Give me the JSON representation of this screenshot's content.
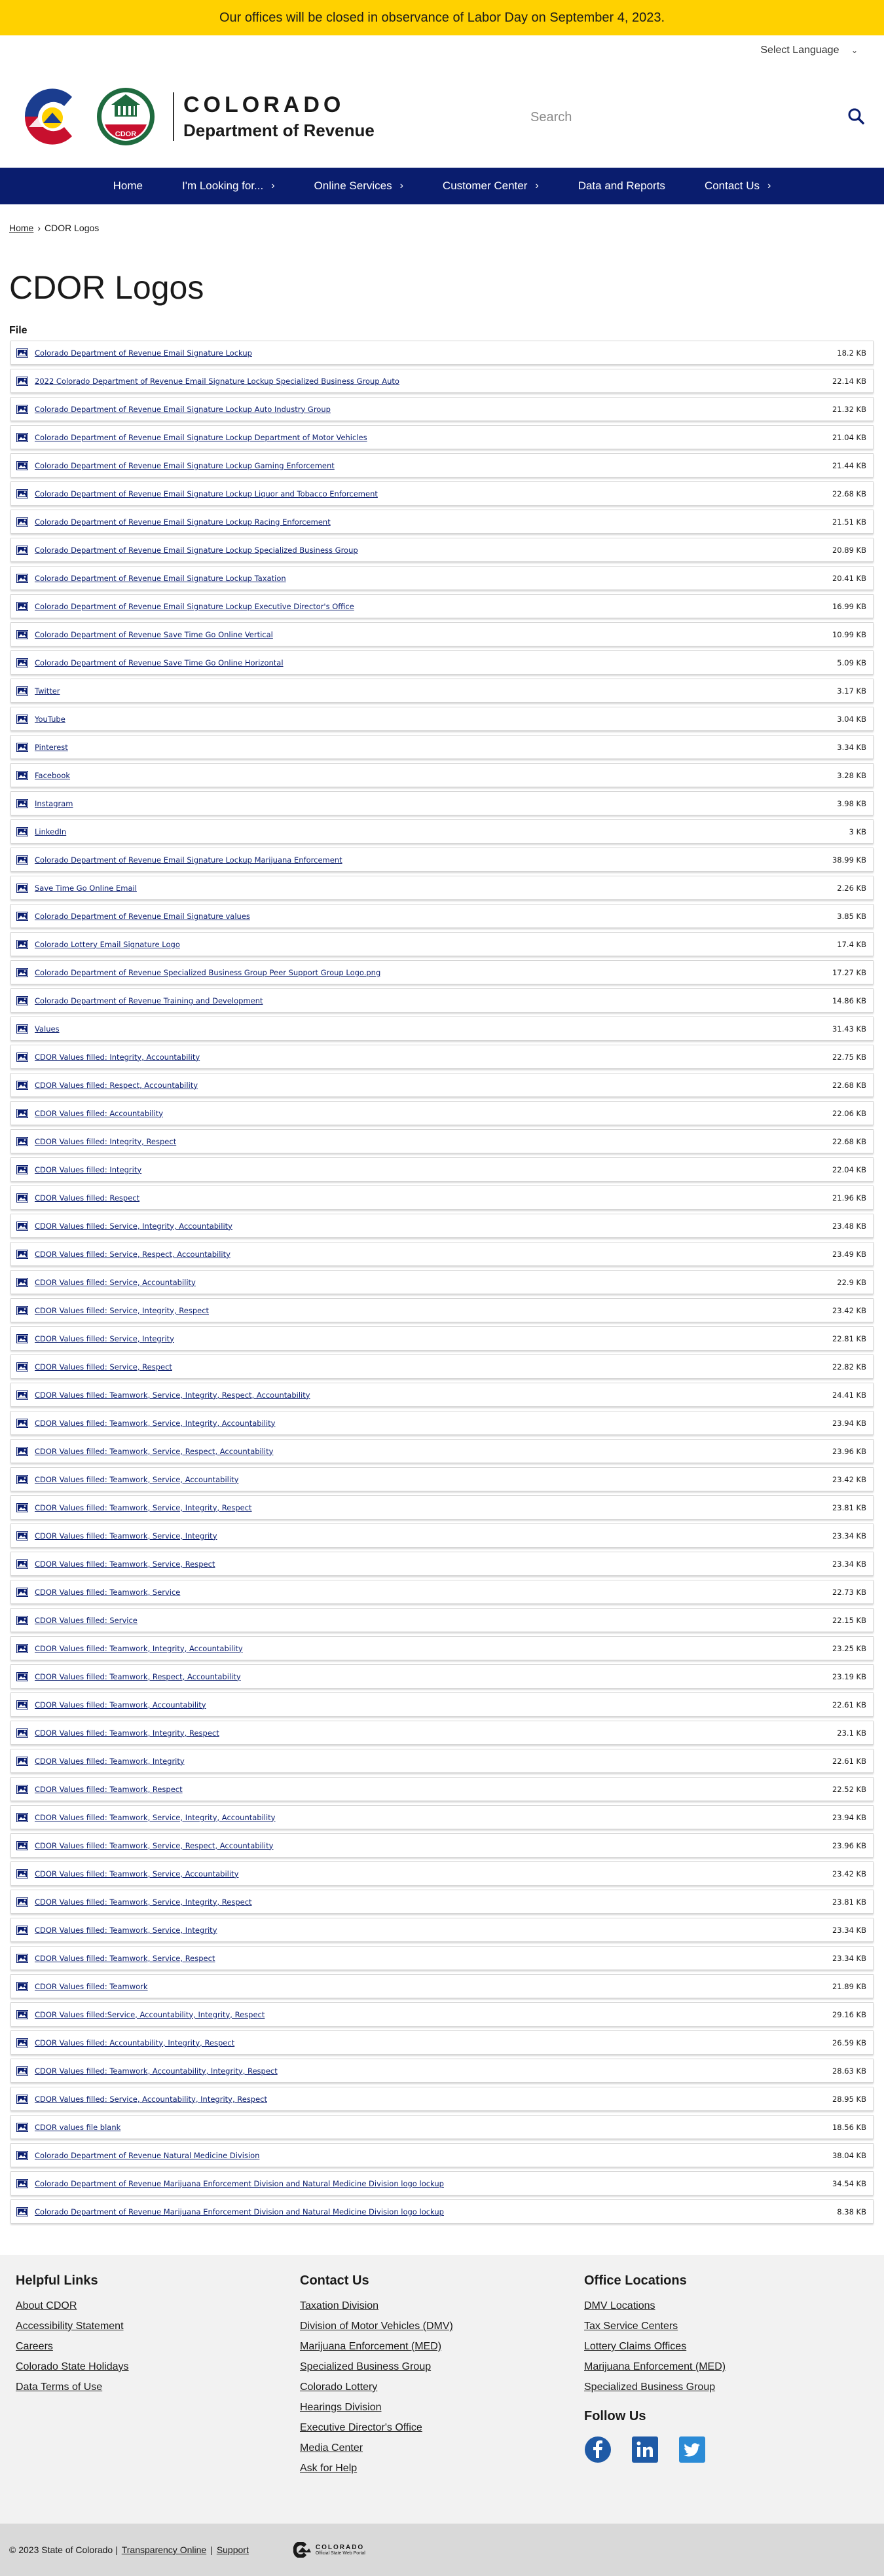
{
  "alert": {
    "text": "Our offices will be closed in observance of Labor Day on September 4, 2023."
  },
  "language": {
    "label": "Select Language"
  },
  "header": {
    "state_name": "COLORADO",
    "dept_name": "Department of Revenue",
    "cdor_badge": "CDOR",
    "search_placeholder": "Search"
  },
  "nav": {
    "items": [
      {
        "label": "Home"
      },
      {
        "label": "I'm Looking for..."
      },
      {
        "label": "Online Services"
      },
      {
        "label": "Customer Center"
      },
      {
        "label": "Data and Reports"
      },
      {
        "label": "Contact Us"
      }
    ]
  },
  "breadcrumb": {
    "home": "Home",
    "current": "CDOR Logos"
  },
  "page_title": "CDOR Logos",
  "file_label": "File",
  "files": [
    {
      "name": "Colorado Department of Revenue Email Signature Lockup",
      "size": "18.2 KB"
    },
    {
      "name": "2022 Colorado Department of Revenue Email Signature Lockup Specialized Business Group Auto",
      "size": "22.14 KB"
    },
    {
      "name": "Colorado Department of Revenue Email Signature Lockup Auto Industry Group",
      "size": "21.32 KB"
    },
    {
      "name": "Colorado Department of Revenue Email Signature Lockup Department of Motor Vehicles",
      "size": "21.04 KB"
    },
    {
      "name": "Colorado Department of Revenue Email Signature Lockup Gaming Enforcement",
      "size": "21.44 KB"
    },
    {
      "name": "Colorado Department of Revenue Email Signature Lockup Liquor and Tobacco Enforcement",
      "size": "22.68 KB"
    },
    {
      "name": "Colorado Department of Revenue Email Signature Lockup Racing Enforcement",
      "size": "21.51 KB"
    },
    {
      "name": "Colorado Department of Revenue Email Signature Lockup Specialized Business Group",
      "size": "20.89 KB"
    },
    {
      "name": "Colorado Department of Revenue Email Signature Lockup Taxation",
      "size": "20.41 KB"
    },
    {
      "name": "Colorado Department of Revenue Email Signature Lockup Executive Director's Office",
      "size": "16.99 KB"
    },
    {
      "name": "Colorado Department of Revenue Save Time Go Online Vertical",
      "size": "10.99 KB"
    },
    {
      "name": "Colorado Department of Revenue Save Time Go Online Horizontal",
      "size": "5.09 KB"
    },
    {
      "name": "Twitter",
      "size": "3.17 KB"
    },
    {
      "name": "YouTube",
      "size": "3.04 KB"
    },
    {
      "name": "Pinterest",
      "size": "3.34 KB"
    },
    {
      "name": "Facebook",
      "size": "3.28 KB"
    },
    {
      "name": "Instagram",
      "size": "3.98 KB"
    },
    {
      "name": "LinkedIn",
      "size": "3 KB"
    },
    {
      "name": "Colorado Department of Revenue Email Signature Lockup Marijuana Enforcement",
      "size": "38.99 KB"
    },
    {
      "name": "Save Time Go Online Email",
      "size": "2.26 KB"
    },
    {
      "name": "Colorado Department of Revenue Email Signature values",
      "size": "3.85 KB"
    },
    {
      "name": "Colorado Lottery Email Signature Logo",
      "size": "17.4 KB"
    },
    {
      "name": "Colorado Department of Revenue Specialized Business Group Peer Support Group Logo.png",
      "size": "17.27 KB"
    },
    {
      "name": "Colorado Department of Revenue Training and Development",
      "size": "14.86 KB"
    },
    {
      "name": "Values",
      "size": "31.43 KB"
    },
    {
      "name": "CDOR Values filled: Integrity, Accountability",
      "size": "22.75 KB"
    },
    {
      "name": "CDOR Values filled: Respect, Accountability",
      "size": "22.68 KB"
    },
    {
      "name": "CDOR Values filled: Accountability",
      "size": "22.06 KB"
    },
    {
      "name": "CDOR Values filled: Integrity, Respect",
      "size": "22.68 KB"
    },
    {
      "name": "CDOR Values filled: Integrity",
      "size": "22.04 KB"
    },
    {
      "name": "CDOR Values filled: Respect",
      "size": "21.96 KB"
    },
    {
      "name": "CDOR Values filled: Service, Integrity, Accountability",
      "size": "23.48 KB"
    },
    {
      "name": "CDOR Values filled: Service, Respect, Accountability",
      "size": "23.49 KB"
    },
    {
      "name": "CDOR Values filled: Service, Accountability",
      "size": "22.9 KB"
    },
    {
      "name": "CDOR Values filled: Service, Integrity, Respect",
      "size": "23.42 KB"
    },
    {
      "name": "CDOR Values filled: Service, Integrity",
      "size": "22.81 KB"
    },
    {
      "name": "CDOR Values filled: Service, Respect",
      "size": "22.82 KB"
    },
    {
      "name": "CDOR Values filled: Teamwork, Service, Integrity, Respect, Accountability",
      "size": "24.41 KB"
    },
    {
      "name": "CDOR Values filled: Teamwork, Service, Integrity, Accountability",
      "size": "23.94 KB"
    },
    {
      "name": "CDOR Values filled: Teamwork, Service, Respect, Accountability",
      "size": "23.96 KB"
    },
    {
      "name": "CDOR Values filled: Teamwork, Service, Accountability",
      "size": "23.42 KB"
    },
    {
      "name": "CDOR Values filled: Teamwork, Service, Integrity, Respect",
      "size": "23.81 KB"
    },
    {
      "name": "CDOR Values filled: Teamwork, Service, Integrity",
      "size": "23.34 KB"
    },
    {
      "name": "CDOR Values filled: Teamwork, Service, Respect",
      "size": "23.34 KB"
    },
    {
      "name": "CDOR Values filled: Teamwork, Service",
      "size": "22.73 KB"
    },
    {
      "name": "CDOR Values filled: Service",
      "size": "22.15 KB"
    },
    {
      "name": "CDOR Values filled: Teamwork, Integrity, Accountability",
      "size": "23.25 KB"
    },
    {
      "name": "CDOR Values filled: Teamwork, Respect, Accountability",
      "size": "23.19 KB"
    },
    {
      "name": "CDOR Values filled: Teamwork, Accountability",
      "size": "22.61 KB"
    },
    {
      "name": "CDOR Values filled: Teamwork, Integrity, Respect",
      "size": "23.1 KB"
    },
    {
      "name": "CDOR Values filled: Teamwork, Integrity",
      "size": "22.61 KB"
    },
    {
      "name": "CDOR Values filled: Teamwork, Respect",
      "size": "22.52 KB"
    },
    {
      "name": "CDOR Values filled: Teamwork, Service, Integrity, Accountability",
      "size": "23.94 KB"
    },
    {
      "name": "CDOR Values filled: Teamwork, Service, Respect, Accountability",
      "size": "23.96 KB"
    },
    {
      "name": "CDOR Values filled: Teamwork, Service, Accountability",
      "size": "23.42 KB"
    },
    {
      "name": "CDOR Values filled: Teamwork, Service, Integrity, Respect",
      "size": "23.81 KB"
    },
    {
      "name": "CDOR Values filled: Teamwork, Service, Integrity",
      "size": "23.34 KB"
    },
    {
      "name": "CDOR Values filled: Teamwork, Service, Respect",
      "size": "23.34 KB"
    },
    {
      "name": "CDOR Values filled: Teamwork",
      "size": "21.89 KB"
    },
    {
      "name": "CDOR Values filled:Service, Accountability, Integrity, Respect",
      "size": "29.16 KB"
    },
    {
      "name": "CDOR Values filled: Accountability, Integrity, Respect",
      "size": "26.59 KB"
    },
    {
      "name": "CDOR Values filled: Teamwork, Accountability, Integrity, Respect",
      "size": "28.63 KB"
    },
    {
      "name": "CDOR Values filled: Service, Accountability, Integrity, Respect",
      "size": "28.95 KB"
    },
    {
      "name": "CDOR values file blank",
      "size": "18.56 KB"
    },
    {
      "name": "Colorado Department of Revenue Natural Medicine Division",
      "size": "38.04 KB"
    },
    {
      "name": "Colorado Department of Revenue Marijuana Enforcement Division and Natural Medicine Division logo lockup",
      "size": "34.54 KB"
    },
    {
      "name": "Colorado Department of Revenue Marijuana Enforcement Division and Natural Medicine Division logo lockup",
      "size": "8.38 KB"
    }
  ],
  "footer": {
    "helpful": {
      "title": "Helpful Links",
      "links": [
        "About CDOR",
        "Accessibility Statement",
        "Careers",
        "Colorado State Holidays",
        "Data Terms of Use"
      ]
    },
    "contact": {
      "title": "Contact Us",
      "links": [
        "Taxation Division",
        "Division of Motor Vehicles (DMV)",
        "Marijuana Enforcement (MED)",
        "Specialized Business Group",
        "Colorado Lottery",
        "Hearings Division",
        "Executive Director's Office",
        "Media Center",
        "Ask for Help"
      ]
    },
    "offices": {
      "title": "Office Locations",
      "links": [
        "DMV Locations",
        "Tax Service Centers",
        "Lottery Claims Offices",
        "Marijuana Enforcement (MED)",
        "Specialized Business Group"
      ]
    },
    "follow": {
      "title": "Follow Us",
      "icons": [
        "facebook-icon",
        "linkedin-icon",
        "twitter-icon"
      ]
    }
  },
  "bottom": {
    "copyright": "© 2023 State of Colorado",
    "transparency": "Transparency Online",
    "support": "Support",
    "logo_text": "COLORADO",
    "logo_sub": "Official State Web Portal"
  },
  "colors": {
    "alert_bg": "#ffd100",
    "nav_bg": "#0a1d6e",
    "link": "#0a1d6e",
    "footer_bg": "#f2f2f2",
    "bottom_bg": "#d9d9d9"
  }
}
